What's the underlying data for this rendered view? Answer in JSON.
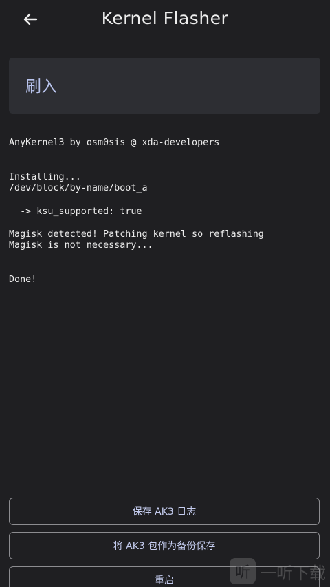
{
  "header": {
    "title": "Kernel Flasher"
  },
  "card": {
    "label": "刷入"
  },
  "log_lines": [
    "AnyKernel3 by osm0sis @ xda-developers",
    "",
    "",
    "Installing...",
    "/dev/block/by-name/boot_a",
    "",
    "  -> ksu_supported: true",
    "",
    "Magisk detected! Patching kernel so reflashing",
    "Magisk is not necessary...",
    "",
    "",
    "Done!"
  ],
  "buttons": {
    "save_log": "保存 AK3 日志",
    "save_backup": "将 AK3 包作为备份保存",
    "reboot": "重启"
  },
  "watermark": {
    "logo_glyph": "听",
    "text": "一听下载"
  },
  "colors": {
    "background": "#1f1f22",
    "card": "#2d2e33",
    "accent": "#c5cdf0"
  }
}
